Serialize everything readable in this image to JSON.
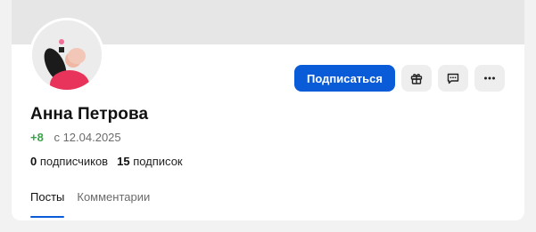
{
  "profile": {
    "name": "Анна Петрова",
    "rating": "+8",
    "since": "с 12.04.2025",
    "followers_count": "0",
    "followers_label": "подписчиков",
    "following_count": "15",
    "following_label": "подписок"
  },
  "actions": {
    "subscribe_label": "Подписаться",
    "icons": [
      "gift-icon",
      "message-icon",
      "more-icon"
    ]
  },
  "tabs": [
    {
      "label": "Посты",
      "active": true
    },
    {
      "label": "Комментарии",
      "active": false
    }
  ],
  "colors": {
    "accent": "#0a5bd8",
    "rating": "#3aa24a",
    "cover": "#e6e6e6",
    "icon_button_bg": "#eeeeee"
  }
}
